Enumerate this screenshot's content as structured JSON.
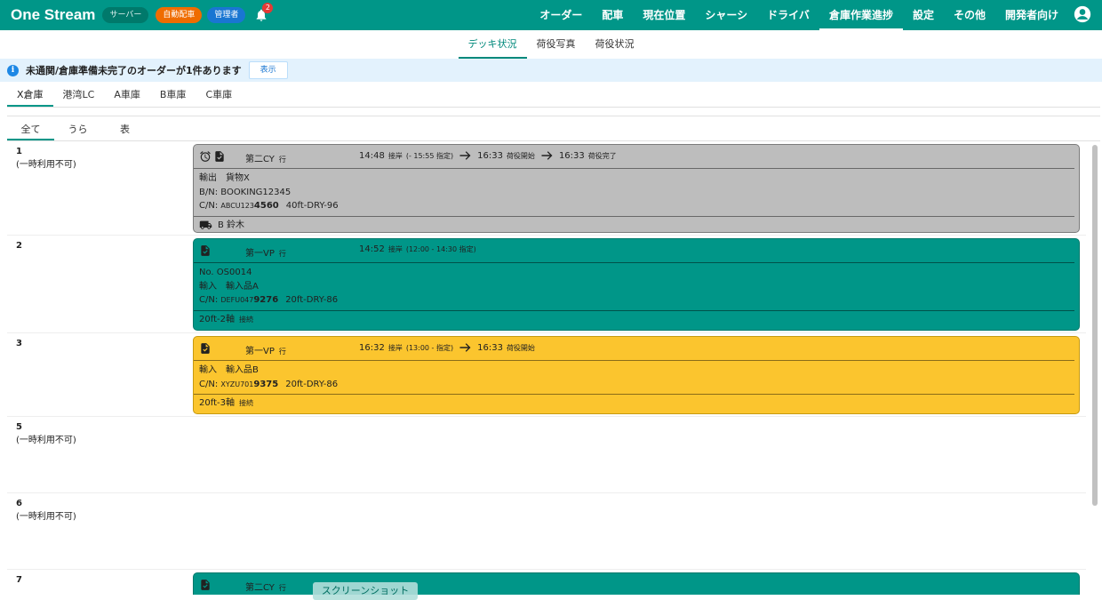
{
  "appbar": {
    "brand": "One Stream",
    "chips": {
      "server": "サーバー",
      "auto": "自動配車",
      "admin": "管理者"
    },
    "notification_count": "2",
    "nav": [
      "オーダー",
      "配車",
      "現在位置",
      "シャーシ",
      "ドライバ",
      "倉庫作業進捗",
      "設定",
      "その他",
      "開発者向け"
    ],
    "active_nav": "倉庫作業進捗"
  },
  "subtabs": [
    "デッキ状況",
    "荷役写真",
    "荷役状況"
  ],
  "alert": {
    "text": "未通関/倉庫準備未完了のオーダーが1件あります",
    "button": "表示"
  },
  "warehouse_tabs": [
    "X倉庫",
    "港湾LC",
    "A車庫",
    "B車庫",
    "C車庫"
  ],
  "filter_tabs": [
    "全て",
    "うら",
    "表"
  ],
  "docks": [
    {
      "number": "1",
      "note": "(一時利用不可)",
      "card": {
        "color": "#bdbdbd",
        "dest": "第二CY",
        "dest_suffix": "行",
        "sched": [
          {
            "time": "14:48",
            "label": "接岸",
            "extra": "(- 15:55  指定)"
          },
          {
            "time": "16:33",
            "label": "荷役開始"
          },
          {
            "time": "16:33",
            "label": "荷役完了"
          }
        ],
        "lines": [
          "輸出　貨物X",
          "B/N: BOOKING12345"
        ],
        "cn": {
          "prefix": "C/N: ",
          "small": "ABCU123",
          "bold": "4560",
          "spec": "40ft-DRY-96"
        },
        "foot": {
          "text": "B 鈴木",
          "sub": ""
        }
      }
    },
    {
      "number": "2",
      "note": "",
      "card": {
        "color": "#009688",
        "dest": "第一VP",
        "dest_suffix": "行",
        "sched": [
          {
            "time": "14:52",
            "label": "接岸",
            "extra": "(12:00 - 14:30  指定)"
          }
        ],
        "lines": [
          "No. OS0014",
          "輸入　輸入品A"
        ],
        "cn": {
          "prefix": "C/N: ",
          "small": "DEFU047",
          "bold": "9276",
          "spec": "20ft-DRY-86"
        },
        "foot": {
          "text": "20ft-2軸",
          "sub": "接続"
        }
      }
    },
    {
      "number": "3",
      "note": "",
      "card": {
        "color": "#fbc52e",
        "dest": "第一VP",
        "dest_suffix": "行",
        "sched": [
          {
            "time": "16:32",
            "label": "接岸",
            "extra": "(13:00 -  指定)"
          },
          {
            "time": "16:33",
            "label": "荷役開始"
          }
        ],
        "lines": [
          "輸入　輸入品B"
        ],
        "cn": {
          "prefix": "C/N: ",
          "small": "XYZU701",
          "bold": "9375",
          "spec": "20ft-DRY-86"
        },
        "foot": {
          "text": "20ft-3軸",
          "sub": "接続"
        }
      }
    },
    {
      "number": "5",
      "note": "(一時利用不可)",
      "card": null
    },
    {
      "number": "6",
      "note": "(一時利用不可)",
      "card": null
    },
    {
      "number": "7",
      "note": "",
      "card": {
        "color": "#009688",
        "dest": "第二CY",
        "dest_suffix": "行",
        "sched": [],
        "lines": [],
        "cn": null,
        "foot": null
      }
    }
  ],
  "overlay_label": "スクリーンショット"
}
